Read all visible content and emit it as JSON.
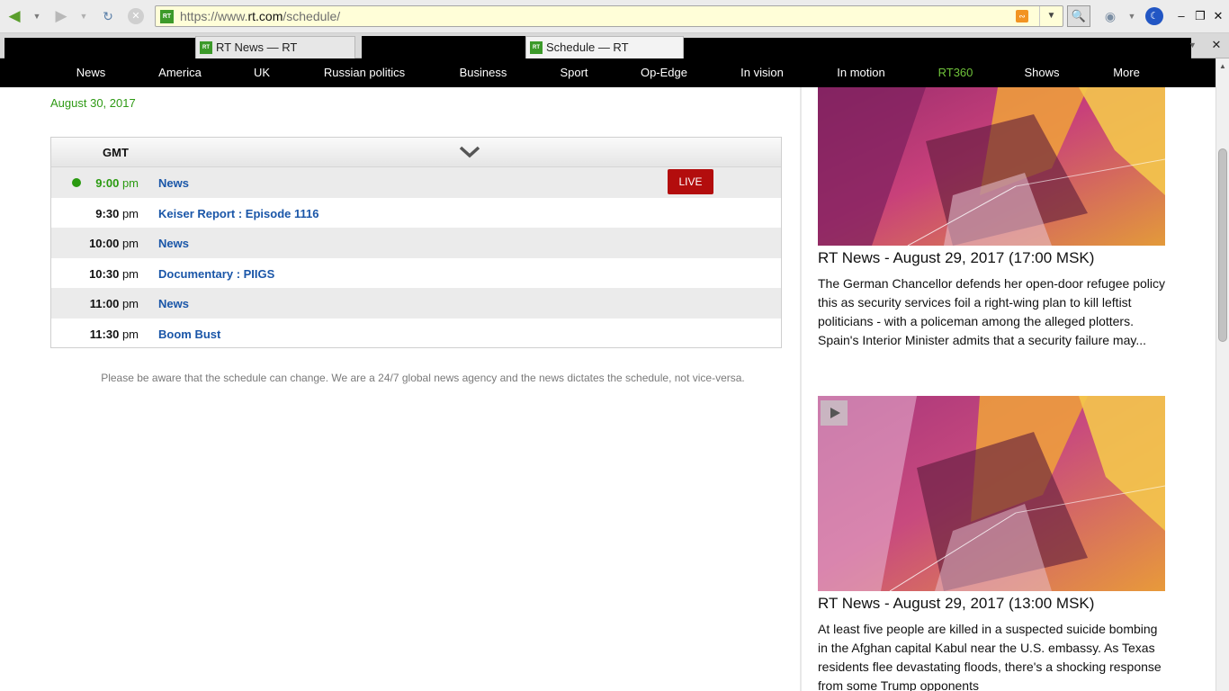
{
  "browser": {
    "url_prefix": "https://www.",
    "url_domain": "rt.com",
    "url_path": "/schedule/",
    "favicon_text": "RT",
    "tabs": [
      {
        "label": "RT News — RT",
        "active": false
      },
      {
        "label": "Schedule — RT",
        "active": true
      }
    ]
  },
  "nav": {
    "items": [
      {
        "label": "News"
      },
      {
        "label": "America"
      },
      {
        "label": "UK"
      },
      {
        "label": "Russian politics"
      },
      {
        "label": "Business"
      },
      {
        "label": "Sport"
      },
      {
        "label": "Op-Edge"
      },
      {
        "label": "In vision"
      },
      {
        "label": "In motion"
      },
      {
        "label": "RT360"
      },
      {
        "label": "Shows"
      },
      {
        "label": "More"
      }
    ],
    "accent_color": "#6fc23a"
  },
  "schedule": {
    "date": "August 30, 2017",
    "timezone": "GMT",
    "live_label": "LIVE",
    "rows": [
      {
        "time": "9:00",
        "period": "pm",
        "title": "News",
        "live": true
      },
      {
        "time": "9:30",
        "period": "pm",
        "title": "Keiser Report : Episode 1116",
        "live": false
      },
      {
        "time": "10:00",
        "period": "pm",
        "title": "News",
        "live": false
      },
      {
        "time": "10:30",
        "period": "pm",
        "title": "Documentary : PIIGS",
        "live": false
      },
      {
        "time": "11:00",
        "period": "pm",
        "title": "News",
        "live": false
      },
      {
        "time": "11:30",
        "period": "pm",
        "title": "Boom Bust",
        "live": false
      }
    ],
    "notice": "Please be aware that the schedule can change. We are a 24/7 global news agency and the news dictates the schedule, not vice-versa."
  },
  "sidebar": {
    "articles": [
      {
        "title": "RT News - August 29, 2017 (17:00 MSK)",
        "body": "The German Chancellor defends her open-door refugee policy this as security services foil a right-wing plan to kill leftist politicians - with a policeman among the alleged plotters. Spain's Interior Minister admits that a security failure may..."
      },
      {
        "title": "RT News - August 29, 2017 (13:00 MSK)",
        "body": "At least five people are killed in a suspected suicide bombing in the Afghan capital Kabul near the U.S. embassy. As Texas residents flee devastating floods, there's a shocking response from some Trump opponents"
      }
    ]
  },
  "colors": {
    "live_green": "#2a9a10",
    "link_blue": "#1a56a8",
    "live_badge": "#b30d0d"
  }
}
